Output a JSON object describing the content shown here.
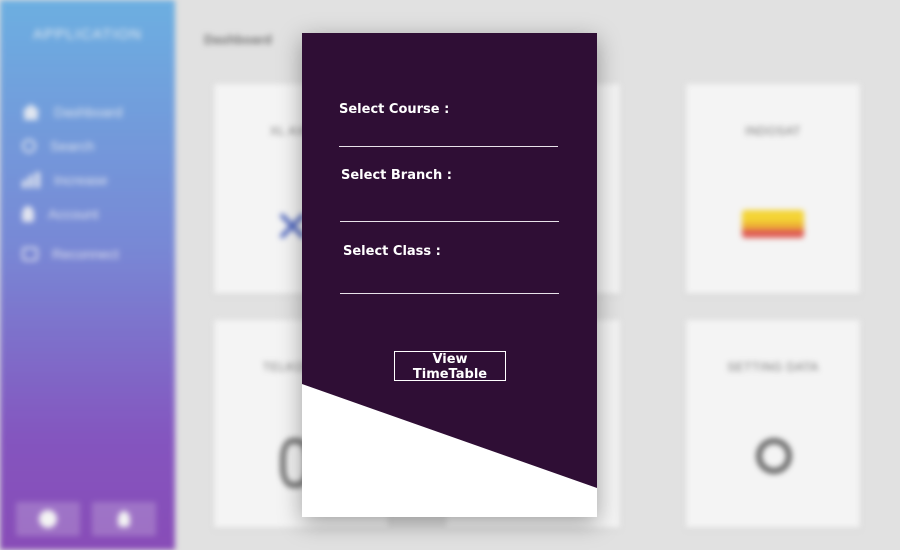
{
  "background": {
    "sidebar": {
      "title": "APPLICATION",
      "items": [
        {
          "label": "Dashboard",
          "icon": "home-icon"
        },
        {
          "label": "Search",
          "icon": "search-icon"
        },
        {
          "label": "Increase",
          "icon": "bar-chart-icon"
        },
        {
          "label": "Account",
          "icon": "user-icon"
        },
        {
          "label": "Reconnect",
          "icon": "reconnect-icon"
        }
      ],
      "bottom_buttons": [
        {
          "icon": "help-icon"
        },
        {
          "icon": "profile-icon"
        }
      ]
    },
    "breadcrumb": "Dashboard",
    "cards": [
      {
        "title": "XL AXIATA",
        "icon": "xl-logo-icon"
      },
      {
        "title": "",
        "icon": ""
      },
      {
        "title": "INDOSAT",
        "icon": "indosat-logo-icon"
      },
      {
        "title": "TELKOMSEL",
        "icon": "link-icon"
      },
      {
        "title": "",
        "icon": ""
      },
      {
        "title": "SETTING DATA",
        "icon": "link-icon"
      }
    ]
  },
  "modal": {
    "course": {
      "label": "Select Course :",
      "value": ""
    },
    "branch": {
      "label": "Select Branch :",
      "value": ""
    },
    "class": {
      "label": "Select Class :",
      "value": ""
    },
    "view_button": "View TimeTable",
    "colors": {
      "background": "#2f0e35",
      "accent": "#ffffff"
    }
  }
}
